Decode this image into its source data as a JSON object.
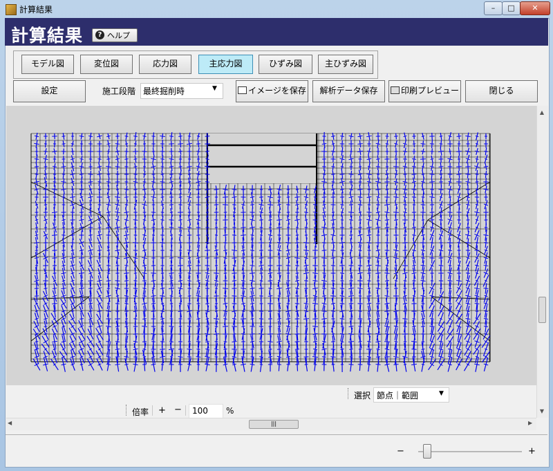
{
  "window": {
    "title": "計算結果",
    "min_glyph": "–",
    "max_glyph": "□",
    "close_glyph": "✕"
  },
  "header": {
    "title": "計算結果",
    "help_label": "ヘルプ",
    "help_glyph": "?"
  },
  "view_tabs": [
    {
      "label": "モデル図",
      "active": false
    },
    {
      "label": "変位図",
      "active": false
    },
    {
      "label": "応力図",
      "active": false
    },
    {
      "label": "主応力図",
      "active": true
    },
    {
      "label": "ひずみ図",
      "active": false
    },
    {
      "label": "主ひずみ図",
      "active": false
    }
  ],
  "toolbar": {
    "settings_label": "設定",
    "stage_label": "施工段階",
    "stage_value": "最終掘削時",
    "save_image_label": "イメージを保存",
    "save_data_label": "解析データ保存",
    "print_preview_label": "印刷プレビュー",
    "close_label": "閉じる"
  },
  "selection": {
    "label": "選択",
    "value": "節点｜範囲"
  },
  "zoom": {
    "label": "倍率",
    "plus": "+",
    "minus": "−",
    "value": "100",
    "unit": "%"
  },
  "statusbar": {
    "minus": "−",
    "plus": "+",
    "slider_level": 0.08
  },
  "colors": {
    "header_bg": "#2d2e6c",
    "active_tab": "#bdebf7",
    "stress_vector": "#0000ee",
    "mesh_line": "#000000",
    "canvas_bg": "#d4d4d4"
  }
}
